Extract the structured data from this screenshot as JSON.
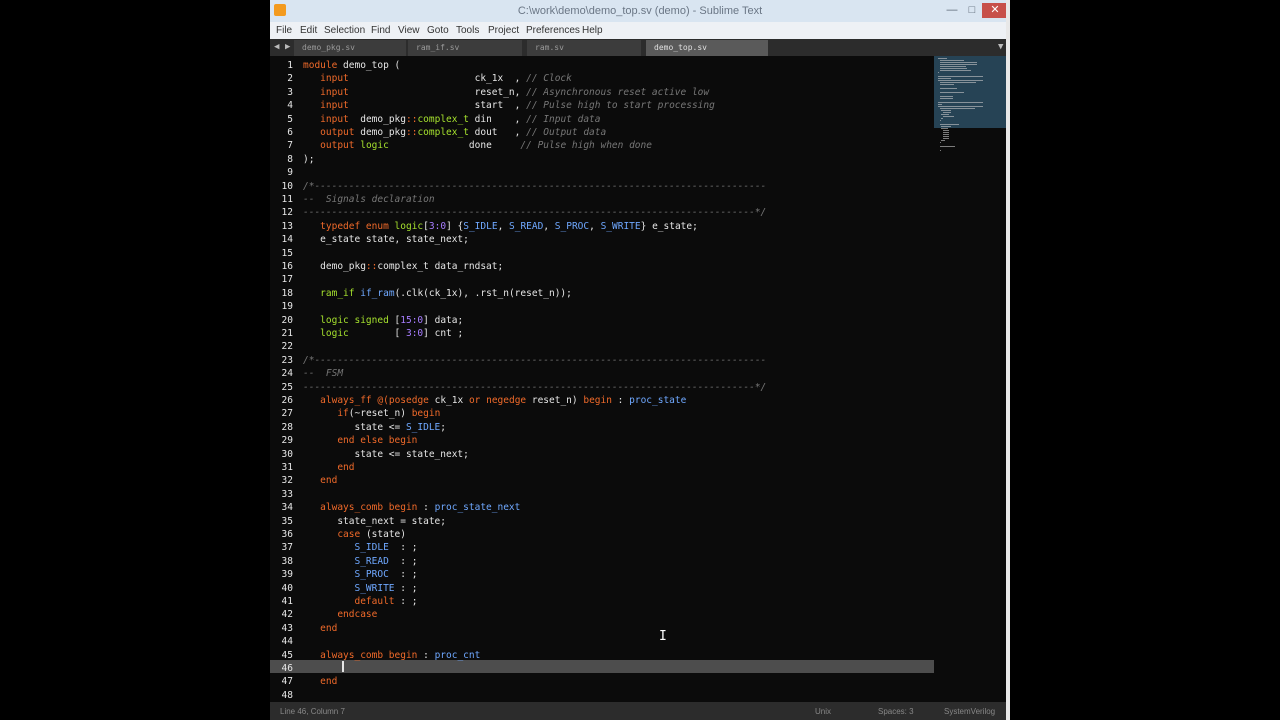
{
  "window": {
    "title": "C:\\work\\demo\\demo_top.sv (demo) - Sublime Text"
  },
  "menu": [
    "File",
    "Edit",
    "Selection",
    "Find",
    "View",
    "Goto",
    "Tools",
    "Project",
    "Preferences",
    "Help"
  ],
  "tabs": [
    {
      "label": "demo_pkg.sv",
      "active": false
    },
    {
      "label": "ram_if.sv",
      "active": false
    },
    {
      "label": "ram.sv",
      "active": false
    },
    {
      "label": "demo_top.sv",
      "active": true
    }
  ],
  "line_numbers": [
    "1",
    "2",
    "3",
    "4",
    "5",
    "6",
    "7",
    "8",
    "9",
    "10",
    "11",
    "12",
    "13",
    "14",
    "15",
    "16",
    "17",
    "18",
    "19",
    "20",
    "21",
    "22",
    "23",
    "24",
    "25",
    "26",
    "27",
    "28",
    "29",
    "30",
    "31",
    "32",
    "33",
    "34",
    "35",
    "36",
    "37",
    "38",
    "39",
    "40",
    "41",
    "42",
    "43",
    "44",
    "45",
    "46",
    "47",
    "48"
  ],
  "current_line": 46,
  "code_lines": [
    [
      [
        "kw",
        "module"
      ],
      [
        "p",
        " demo_top ("
      ]
    ],
    [
      [
        "p",
        "   "
      ],
      [
        "kw",
        "input"
      ],
      [
        "p",
        "                      ck_1x  , "
      ],
      [
        "cm",
        "// Clock"
      ]
    ],
    [
      [
        "p",
        "   "
      ],
      [
        "kw",
        "input"
      ],
      [
        "p",
        "                      reset_n, "
      ],
      [
        "cm",
        "// Asynchronous reset active low"
      ]
    ],
    [
      [
        "p",
        "   "
      ],
      [
        "kw",
        "input"
      ],
      [
        "p",
        "                      start  , "
      ],
      [
        "cm",
        "// Pulse high to start processing"
      ]
    ],
    [
      [
        "p",
        "   "
      ],
      [
        "kw",
        "input"
      ],
      [
        "p",
        "  demo_pkg"
      ],
      [
        "kw",
        "::"
      ],
      [
        "ty",
        "complex_t"
      ],
      [
        "p",
        " din    , "
      ],
      [
        "cm",
        "// Input data"
      ]
    ],
    [
      [
        "p",
        "   "
      ],
      [
        "kw",
        "output"
      ],
      [
        "p",
        " demo_pkg"
      ],
      [
        "kw",
        "::"
      ],
      [
        "ty",
        "complex_t"
      ],
      [
        "p",
        " dout   , "
      ],
      [
        "cm",
        "// Output data"
      ]
    ],
    [
      [
        "p",
        "   "
      ],
      [
        "kw",
        "output"
      ],
      [
        "p",
        " "
      ],
      [
        "ty",
        "logic"
      ],
      [
        "p",
        "              done     "
      ],
      [
        "cm",
        "// Pulse high when done"
      ]
    ],
    [
      [
        "p",
        ");"
      ]
    ],
    [
      [
        "p",
        ""
      ]
    ],
    [
      [
        "cm",
        "/*-------------------------------------------------------------------------------"
      ]
    ],
    [
      [
        "cm",
        "--  Signals declaration"
      ]
    ],
    [
      [
        "cm",
        "-------------------------------------------------------------------------------*/"
      ]
    ],
    [
      [
        "p",
        "   "
      ],
      [
        "kw",
        "typedef enum"
      ],
      [
        "p",
        " "
      ],
      [
        "ty",
        "logic"
      ],
      [
        "p",
        "["
      ],
      [
        "nm",
        "3:0"
      ],
      [
        "p",
        "] {"
      ],
      [
        "id",
        "S_IDLE"
      ],
      [
        "p",
        ", "
      ],
      [
        "id",
        "S_READ"
      ],
      [
        "p",
        ", "
      ],
      [
        "id",
        "S_PROC"
      ],
      [
        "p",
        ", "
      ],
      [
        "id",
        "S_WRITE"
      ],
      [
        "p",
        "} e_state;"
      ]
    ],
    [
      [
        "p",
        "   e_state state, state_next;"
      ]
    ],
    [
      [
        "p",
        ""
      ]
    ],
    [
      [
        "p",
        "   demo_pkg"
      ],
      [
        "kw",
        "::"
      ],
      [
        "p",
        "complex_t data_rndsat;"
      ]
    ],
    [
      [
        "p",
        ""
      ]
    ],
    [
      [
        "p",
        "   "
      ],
      [
        "ty",
        "ram_if"
      ],
      [
        "p",
        " "
      ],
      [
        "id",
        "if_ram"
      ],
      [
        "p",
        "(.clk(ck_1x), .rst_n(reset_n));"
      ]
    ],
    [
      [
        "p",
        ""
      ]
    ],
    [
      [
        "p",
        "   "
      ],
      [
        "ty",
        "logic signed"
      ],
      [
        "p",
        " ["
      ],
      [
        "nm",
        "15:0"
      ],
      [
        "p",
        "] data;"
      ]
    ],
    [
      [
        "p",
        "   "
      ],
      [
        "ty",
        "logic"
      ],
      [
        "p",
        "        [ "
      ],
      [
        "nm",
        "3:0"
      ],
      [
        "p",
        "] cnt ;"
      ]
    ],
    [
      [
        "p",
        ""
      ]
    ],
    [
      [
        "cm",
        "/*-------------------------------------------------------------------------------"
      ]
    ],
    [
      [
        "cm",
        "--  FSM"
      ]
    ],
    [
      [
        "cm",
        "-------------------------------------------------------------------------------*/"
      ]
    ],
    [
      [
        "p",
        "   "
      ],
      [
        "kw",
        "always_ff"
      ],
      [
        "p",
        " "
      ],
      [
        "kw",
        "@("
      ],
      [
        "kw",
        "posedge"
      ],
      [
        "p",
        " ck_1x "
      ],
      [
        "kw",
        "or negedge"
      ],
      [
        "p",
        " reset_n) "
      ],
      [
        "kw",
        "begin"
      ],
      [
        "p",
        " : "
      ],
      [
        "id",
        "proc_state"
      ]
    ],
    [
      [
        "p",
        "      "
      ],
      [
        "kw",
        "if"
      ],
      [
        "p",
        "(~reset_n) "
      ],
      [
        "kw",
        "begin"
      ]
    ],
    [
      [
        "p",
        "         state <= "
      ],
      [
        "id",
        "S_IDLE"
      ],
      [
        "p",
        ";"
      ]
    ],
    [
      [
        "p",
        "      "
      ],
      [
        "kw",
        "end else begin"
      ]
    ],
    [
      [
        "p",
        "         state <= state_next;"
      ]
    ],
    [
      [
        "p",
        "      "
      ],
      [
        "kw",
        "end"
      ]
    ],
    [
      [
        "p",
        "   "
      ],
      [
        "kw",
        "end"
      ]
    ],
    [
      [
        "p",
        ""
      ]
    ],
    [
      [
        "p",
        "   "
      ],
      [
        "kw",
        "always_comb begin"
      ],
      [
        "p",
        " : "
      ],
      [
        "id",
        "proc_state_next"
      ]
    ],
    [
      [
        "p",
        "      state_next = state;"
      ]
    ],
    [
      [
        "p",
        "      "
      ],
      [
        "kw",
        "case"
      ],
      [
        "p",
        " (state)"
      ]
    ],
    [
      [
        "p",
        "         "
      ],
      [
        "id",
        "S_IDLE"
      ],
      [
        "p",
        "  : ;"
      ]
    ],
    [
      [
        "p",
        "         "
      ],
      [
        "id",
        "S_READ"
      ],
      [
        "p",
        "  : ;"
      ]
    ],
    [
      [
        "p",
        "         "
      ],
      [
        "id",
        "S_PROC"
      ],
      [
        "p",
        "  : ;"
      ]
    ],
    [
      [
        "p",
        "         "
      ],
      [
        "id",
        "S_WRITE"
      ],
      [
        "p",
        " : ;"
      ]
    ],
    [
      [
        "p",
        "         "
      ],
      [
        "kw",
        "default"
      ],
      [
        "p",
        " : ;"
      ]
    ],
    [
      [
        "p",
        "      "
      ],
      [
        "kw",
        "endcase"
      ]
    ],
    [
      [
        "p",
        "   "
      ],
      [
        "kw",
        "end"
      ]
    ],
    [
      [
        "p",
        ""
      ]
    ],
    [
      [
        "p",
        "   "
      ],
      [
        "kw",
        "always_comb begin"
      ],
      [
        "p",
        " : "
      ],
      [
        "id",
        "proc_cnt"
      ]
    ],
    [
      [
        "p",
        ""
      ]
    ],
    [
      [
        "p",
        "   "
      ],
      [
        "kw",
        "end"
      ]
    ],
    [
      [
        "p",
        ""
      ]
    ]
  ],
  "status": {
    "position": "Line 46, Column 7",
    "tab_size": "Spaces: 3",
    "syntax": "SystemVerilog",
    "line_ending": "Unix"
  }
}
